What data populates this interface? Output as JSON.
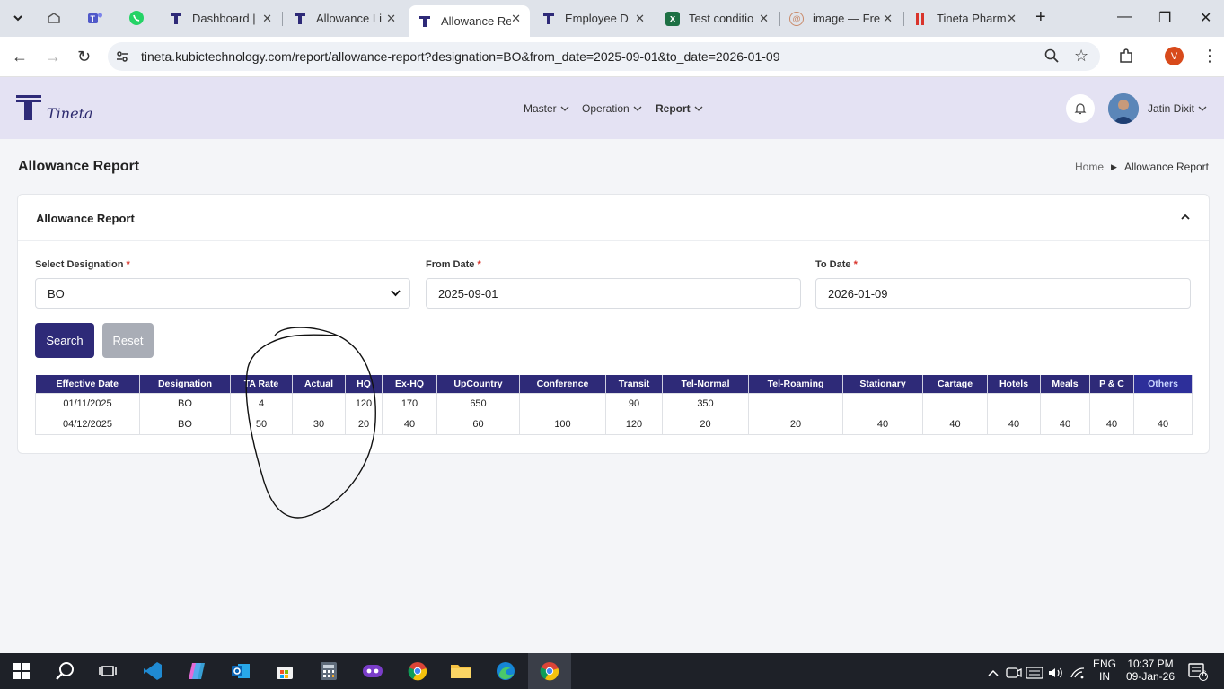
{
  "browser": {
    "tabs": [
      {
        "title": "Dashboard |",
        "icon": "tineta-logo-icon"
      },
      {
        "title": "Allowance Li",
        "icon": "tineta-logo-icon"
      },
      {
        "title": "Allowance Re",
        "icon": "tineta-logo-icon",
        "active": true
      },
      {
        "title": "Employee D",
        "icon": "tineta-logo-icon"
      },
      {
        "title": "Test conditio",
        "icon": "excel-icon"
      },
      {
        "title": "image — Fre",
        "icon": "image-icon"
      },
      {
        "title": "Tineta Pharm",
        "icon": "tineta-pharma-icon"
      }
    ],
    "url": "tineta.kubictechnology.com/report/allowance-report?designation=BO&from_date=2025-09-01&to_date=2026-01-09",
    "profile_initial": "V"
  },
  "app": {
    "logo_text": "Tineta",
    "nav": [
      {
        "label": "Master"
      },
      {
        "label": "Operation"
      },
      {
        "label": "Report"
      }
    ],
    "user_name": "Jatin Dixit"
  },
  "page": {
    "title": "Allowance Report",
    "breadcrumb": {
      "home": "Home",
      "current": "Allowance Report"
    },
    "card_title": "Allowance Report",
    "form": {
      "designation_label": "Select Designation",
      "designation_value": "BO",
      "from_label": "From Date",
      "from_value": "2025-09-01",
      "to_label": "To Date",
      "to_value": "2026-01-09",
      "required_mark": "*"
    },
    "buttons": {
      "search": "Search",
      "reset": "Reset"
    },
    "table": {
      "headers": [
        "Effective Date",
        "Designation",
        "TA Rate",
        "Actual",
        "HQ",
        "Ex-HQ",
        "UpCountry",
        "Conference",
        "Transit",
        "Tel-Normal",
        "Tel-Roaming",
        "Stationary",
        "Cartage",
        "Hotels",
        "Meals",
        "P & C",
        "Others"
      ],
      "rows": [
        [
          "01/11/2025",
          "BO",
          "4",
          "",
          "120",
          "170",
          "650",
          "",
          "90",
          "350",
          "",
          "",
          "",
          "",
          "",
          "",
          ""
        ],
        [
          "04/12/2025",
          "BO",
          "50",
          "30",
          "20",
          "40",
          "60",
          "100",
          "120",
          "20",
          "20",
          "40",
          "40",
          "40",
          "40",
          "40",
          "40"
        ]
      ]
    }
  },
  "taskbar": {
    "lang": "ENG",
    "region": "IN",
    "time": "10:37 PM",
    "date": "09-Jan-26",
    "notif_count": "6"
  }
}
